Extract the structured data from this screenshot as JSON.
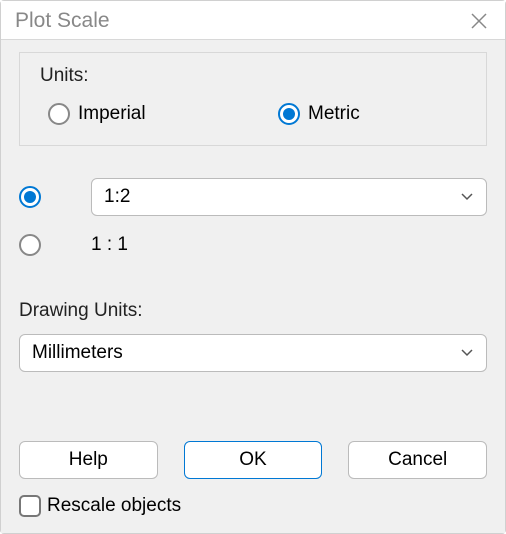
{
  "dialog": {
    "title": "Plot Scale"
  },
  "units": {
    "label": "Units:",
    "imperial": "Imperial",
    "metric": "Metric",
    "selected": "metric"
  },
  "scale": {
    "selected": "custom",
    "custom_value": "1:2",
    "fixed_label": "1 : 1"
  },
  "drawing_units": {
    "label": "Drawing Units:",
    "value": "Millimeters"
  },
  "buttons": {
    "help": "Help",
    "ok": "OK",
    "cancel": "Cancel"
  },
  "rescale": {
    "label": "Rescale objects",
    "checked": false
  }
}
